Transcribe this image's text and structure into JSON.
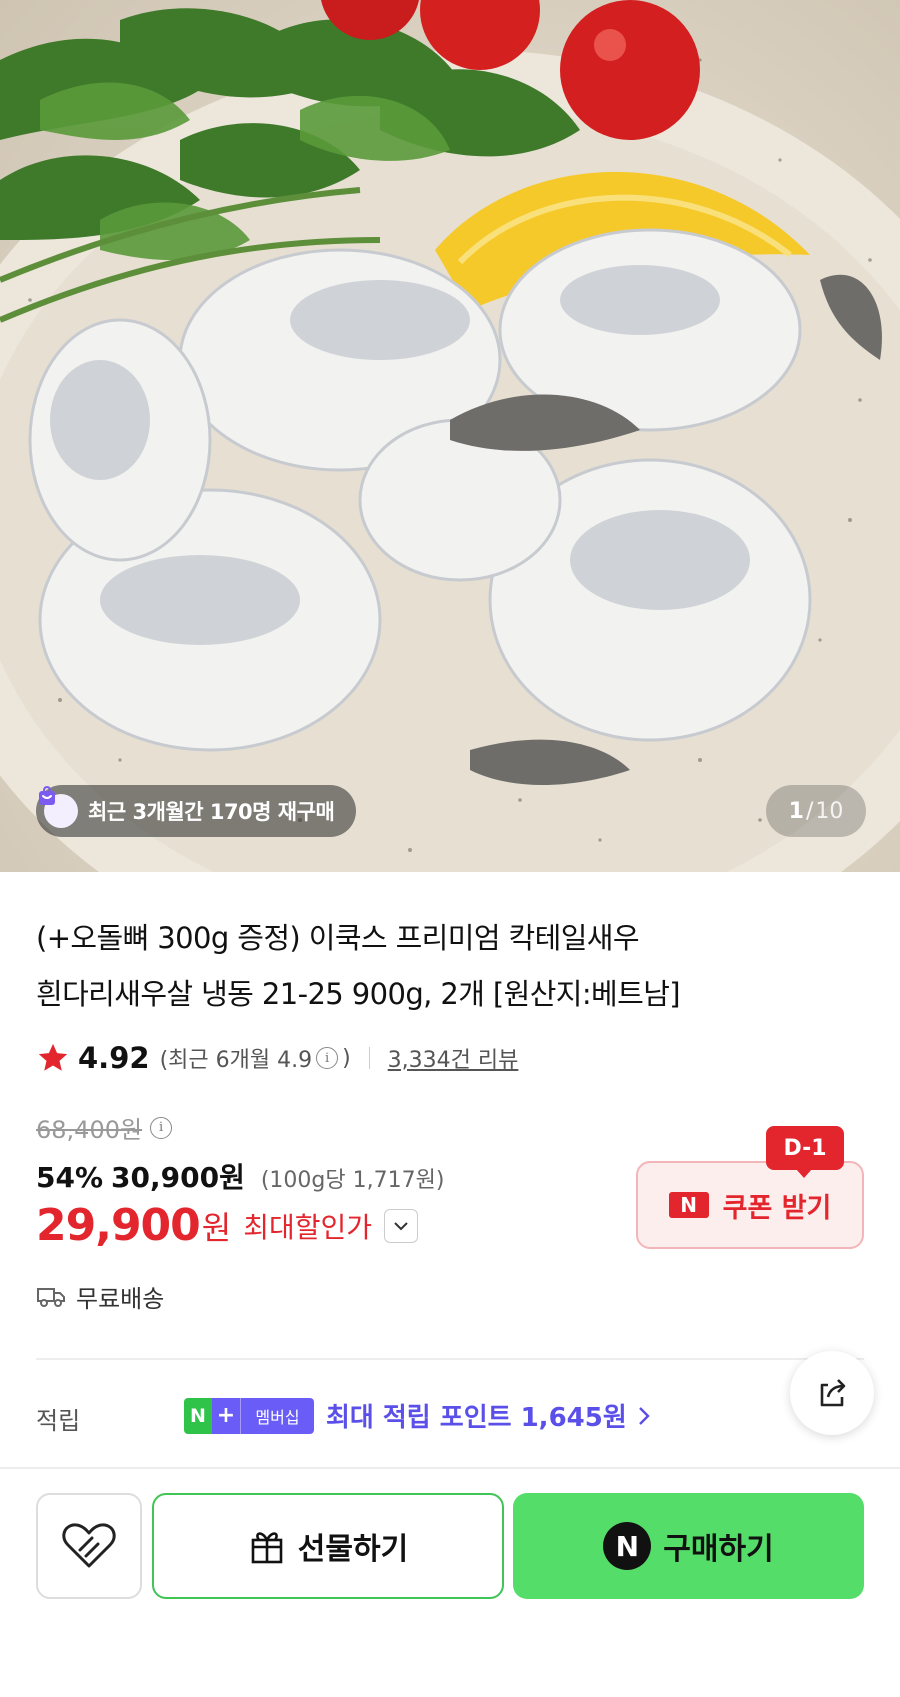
{
  "hero": {
    "badge_text": "최근 3개월간 170명 재구매",
    "counter_current": "1",
    "counter_sep": "/",
    "counter_total": "10"
  },
  "product": {
    "title_line1": "(+오돌뼈 300g 증정) 이쿡스 프리미엄 칵테일새우",
    "title_line2": "흰다리새우살 냉동 21-25 900g, 2개 [원산지:베트남]"
  },
  "rating": {
    "score": "4.92",
    "recent_prefix": "(최근 6개월 4.9",
    "recent_suffix": ")",
    "reviews": "3,334건 리뷰",
    "star_color": "#e3262d"
  },
  "price": {
    "original": "68,400원",
    "discount_pct": "54%",
    "discount_price": "30,900원",
    "unit_price": "(100g당 1,717원)",
    "final_amount": "29,900",
    "final_won": "원",
    "final_label": "최대할인가",
    "accent_color": "#e3262d"
  },
  "coupon": {
    "dday": "D-1",
    "logo": "N",
    "label": "쿠폰 받기"
  },
  "shipping": {
    "label": "무료배송",
    "icon": "truck-icon"
  },
  "points": {
    "label": "적립",
    "n": "N",
    "plus": "+",
    "membership": "멤버십",
    "text": "최대 적립 포인트 1,645원",
    "color": "#5b4fe9"
  },
  "actions": {
    "gift_label": "선물하기",
    "buy_logo": "N",
    "buy_label": "구매하기",
    "buy_color": "#55dd6a"
  }
}
